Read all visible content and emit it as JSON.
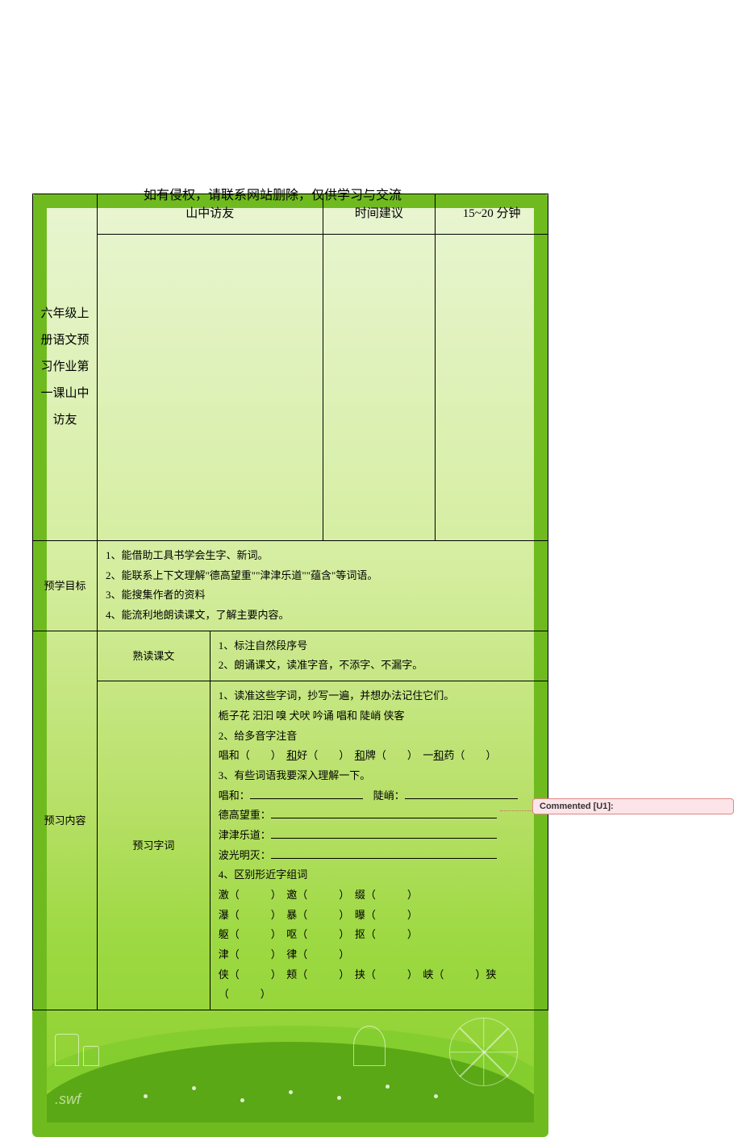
{
  "notice": "如有侵权，请联系网站删除，仅供学习与交流",
  "header": {
    "title_left": "六年级上册语文预习作业第一课山中访友",
    "subject": "山中访友",
    "time_label": "时间建议",
    "time_value": "15~20 分钟"
  },
  "goals": {
    "label": "预学目标",
    "items": [
      "1、能借助工具书学会生字、新词。",
      "2、能联系上下文理解\"德高望重\"\"津津乐道\"\"蕴含\"等词语。",
      "3、能搜集作者的资料",
      "4、能流利地朗读课文，了解主要内容。"
    ]
  },
  "preview": {
    "label": "预习内容",
    "reading": {
      "label": "熟读课文",
      "items": [
        "1、标注自然段序号",
        "2、朗诵课文，读准字音，不添字、不漏字。"
      ]
    },
    "words": {
      "label": "预习字词",
      "section1_title": "1、读准这些字词，抄写一遍，并想办法记住它们。",
      "section1_words": "栀子花  汩汩  嗅  犬吠  吟诵  唱和  陡峭  侠客",
      "section2_title": "2、给多音字注音",
      "polyphone_line": "唱和（　　）　和好（　　）　和牌（　　）　一和药（　　）",
      "polyphone_underlined": [
        "和",
        "和",
        "和"
      ],
      "section3_title": "3、有些词语我要深入理解一下。",
      "definitions": [
        {
          "term": "唱和：",
          "term2": "陡峭："
        },
        {
          "term": "德高望重："
        },
        {
          "term": "津津乐道："
        },
        {
          "term": "波光明灭："
        }
      ],
      "section4_title": "4、区别形近字组词",
      "pairs": [
        [
          "激（　　　）",
          "邀（　　　）",
          "缀（　　　）",
          ""
        ],
        [
          "瀑（　　　）",
          "暴（　　　）",
          "曝（　　　）",
          ""
        ],
        [
          "躯（　　　）",
          "呕（　　　）",
          "抠（　　　）",
          ""
        ],
        [
          "津（　　　）",
          "律（　　　）",
          "",
          ""
        ],
        [
          "侠（　　　）",
          "颊（　　　）",
          "挟（　　　）",
          "峡（　　　）狭（　　　）"
        ]
      ]
    }
  },
  "comment": {
    "label": "Commented [U1]:"
  },
  "swf": ".swf"
}
